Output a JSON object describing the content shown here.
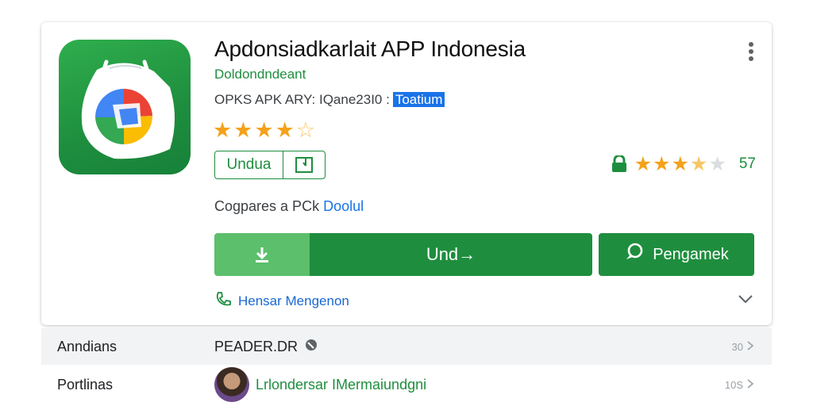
{
  "app": {
    "title": "Apdonsiadkarlait APP Indonesia",
    "developer": "Doldondndeant",
    "meta_prefix": "OPKS APK ARY: IQane23I0 :",
    "meta_tag": "Toatium"
  },
  "rating": {
    "value": 4.5,
    "max": 5
  },
  "outline_button": {
    "label": "Undua"
  },
  "secondary_rating": {
    "value": 3.5,
    "max": 5,
    "count": "57"
  },
  "compare": {
    "text": "Cogpares a PCk ",
    "link": "Doolul"
  },
  "download_button": {
    "label": "Und→"
  },
  "secondary_button": {
    "label": "Pengamek"
  },
  "contact": {
    "label": "Hensar Mengenon"
  },
  "details": [
    {
      "key": "Anndians",
      "value": "PEADER.DR",
      "right": "30"
    },
    {
      "key": "Portlinas",
      "value": "Lrlondersar IMermaiundgni",
      "right": "10S"
    }
  ],
  "colors": {
    "accent_green": "#1e8e3e",
    "light_green": "#5cbf6b",
    "link_blue": "#1a73e8",
    "star": "#f4a21b"
  },
  "icons": [
    "app-icon",
    "more-vert-icon",
    "star-icon",
    "external-link-icon",
    "lock-icon",
    "download-icon",
    "chat-icon",
    "phone-icon",
    "chevron-down-icon",
    "globe-icon",
    "chevron-right-icon"
  ]
}
